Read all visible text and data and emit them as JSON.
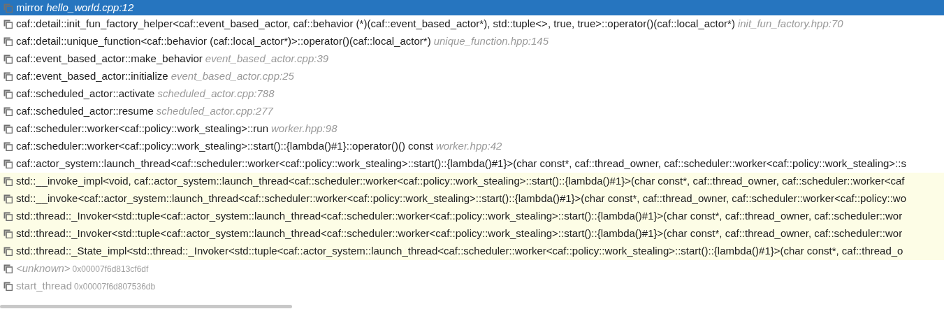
{
  "frames": [
    {
      "kind": "source",
      "selected": true,
      "library": false,
      "function": "mirror",
      "location": "hello_world.cpp:12"
    },
    {
      "kind": "source",
      "selected": false,
      "library": false,
      "function": "caf::detail::init_fun_factory_helper<caf::event_based_actor, caf::behavior (*)(caf::event_based_actor*), std::tuple<>, true, true>::operator()(caf::local_actor*)",
      "location": "init_fun_factory.hpp:70"
    },
    {
      "kind": "source",
      "selected": false,
      "library": false,
      "function": "caf::detail::unique_function<caf::behavior (caf::local_actor*)>::operator()(caf::local_actor*)",
      "location": "unique_function.hpp:145"
    },
    {
      "kind": "source",
      "selected": false,
      "library": false,
      "function": "caf::event_based_actor::make_behavior",
      "location": "event_based_actor.cpp:39"
    },
    {
      "kind": "source",
      "selected": false,
      "library": false,
      "function": "caf::event_based_actor::initialize",
      "location": "event_based_actor.cpp:25"
    },
    {
      "kind": "source",
      "selected": false,
      "library": false,
      "function": "caf::scheduled_actor::activate",
      "location": "scheduled_actor.cpp:788"
    },
    {
      "kind": "source",
      "selected": false,
      "library": false,
      "function": "caf::scheduled_actor::resume",
      "location": "scheduled_actor.cpp:277"
    },
    {
      "kind": "source",
      "selected": false,
      "library": false,
      "function": "caf::scheduler::worker<caf::policy::work_stealing>::run",
      "location": "worker.hpp:98"
    },
    {
      "kind": "source",
      "selected": false,
      "library": false,
      "function": "caf::scheduler::worker<caf::policy::work_stealing>::start()::{lambda()#1}::operator()() const",
      "location": "worker.hpp:42"
    },
    {
      "kind": "source",
      "selected": false,
      "library": false,
      "function": "caf::actor_system::launch_thread<caf::scheduler::worker<caf::policy::work_stealing>::start()::{lambda()#1}>(char const*, caf::thread_owner, caf::scheduler::worker<caf::policy::work_stealing>::s"
    },
    {
      "kind": "source",
      "selected": false,
      "library": true,
      "function": "std::__invoke_impl<void, caf::actor_system::launch_thread<caf::scheduler::worker<caf::policy::work_stealing>::start()::{lambda()#1}>(char const*, caf::thread_owner, caf::scheduler::worker<caf"
    },
    {
      "kind": "source",
      "selected": false,
      "library": true,
      "function": "std::__invoke<caf::actor_system::launch_thread<caf::scheduler::worker<caf::policy::work_stealing>::start()::{lambda()#1}>(char const*, caf::thread_owner, caf::scheduler::worker<caf::policy::wo"
    },
    {
      "kind": "source",
      "selected": false,
      "library": true,
      "function": "std::thread::_Invoker<std::tuple<caf::actor_system::launch_thread<caf::scheduler::worker<caf::policy::work_stealing>::start()::{lambda()#1}>(char const*, caf::thread_owner, caf::scheduler::wor"
    },
    {
      "kind": "source",
      "selected": false,
      "library": true,
      "function": "std::thread::_Invoker<std::tuple<caf::actor_system::launch_thread<caf::scheduler::worker<caf::policy::work_stealing>::start()::{lambda()#1}>(char const*, caf::thread_owner, caf::scheduler::wor"
    },
    {
      "kind": "source",
      "selected": false,
      "library": true,
      "function": "std::thread::_State_impl<std::thread::_Invoker<std::tuple<caf::actor_system::launch_thread<caf::scheduler::worker<caf::policy::work_stealing>::start()::{lambda()#1}>(char const*, caf::thread_o"
    },
    {
      "kind": "unresolved",
      "selected": false,
      "library": false,
      "function": "<unknown>",
      "address": "0x00007f6d813cf6df"
    },
    {
      "kind": "no_debug",
      "selected": false,
      "library": false,
      "function": "start_thread",
      "address": "0x00007f6d807536db"
    }
  ]
}
